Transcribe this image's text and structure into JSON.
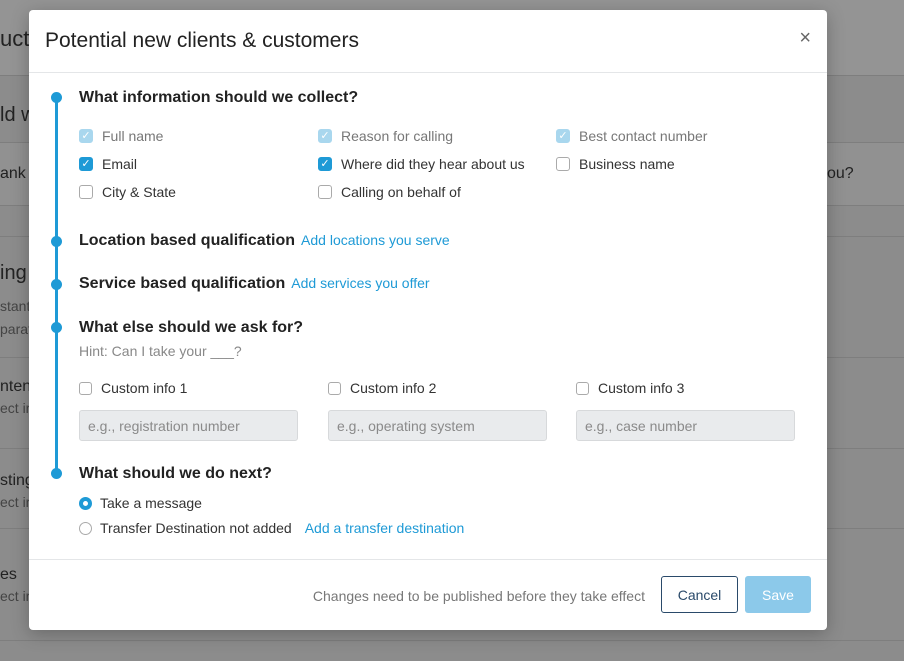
{
  "background": {
    "fragments": [
      "uct",
      "ld w",
      "ank y",
      "ou?",
      "ing",
      "stant",
      "parat",
      "ntent",
      "ect ir",
      "sting",
      "ect ir",
      "es",
      "ect ir"
    ]
  },
  "modal": {
    "title": "Potential new clients & customers",
    "close_icon": "×",
    "sections": {
      "collect": {
        "title": "What information should we collect?",
        "fields": [
          {
            "label": "Full name",
            "state": "checked-disabled"
          },
          {
            "label": "Reason for calling",
            "state": "checked-disabled"
          },
          {
            "label": "Best contact number",
            "state": "checked-disabled"
          },
          {
            "label": "Email",
            "state": "checked"
          },
          {
            "label": "Where did they hear about us",
            "state": "checked"
          },
          {
            "label": "Business name",
            "state": "unchecked"
          },
          {
            "label": "City & State",
            "state": "unchecked"
          },
          {
            "label": "Calling on behalf of",
            "state": "unchecked"
          }
        ]
      },
      "location": {
        "title": "Location based qualification",
        "link": "Add locations you serve"
      },
      "service": {
        "title": "Service based qualification",
        "link": "Add services you offer"
      },
      "ask": {
        "title": "What else should we ask for?",
        "hint": "Hint: Can I take your ___?",
        "custom": [
          {
            "label": "Custom info 1",
            "placeholder": "e.g., registration number"
          },
          {
            "label": "Custom info 2",
            "placeholder": "e.g., operating system"
          },
          {
            "label": "Custom info 3",
            "placeholder": "e.g., case number"
          }
        ]
      },
      "next": {
        "title": "What should we do next?",
        "options": [
          {
            "label": "Take a message",
            "selected": true
          },
          {
            "label": "Transfer Destination not added",
            "selected": false
          }
        ],
        "link": "Add a transfer destination"
      }
    },
    "footer": {
      "note": "Changes need to be published before they take effect",
      "cancel_label": "Cancel",
      "save_label": "Save"
    },
    "colors": {
      "accent": "#1e9ad6",
      "save_disabled": "#8cc9ea"
    }
  }
}
